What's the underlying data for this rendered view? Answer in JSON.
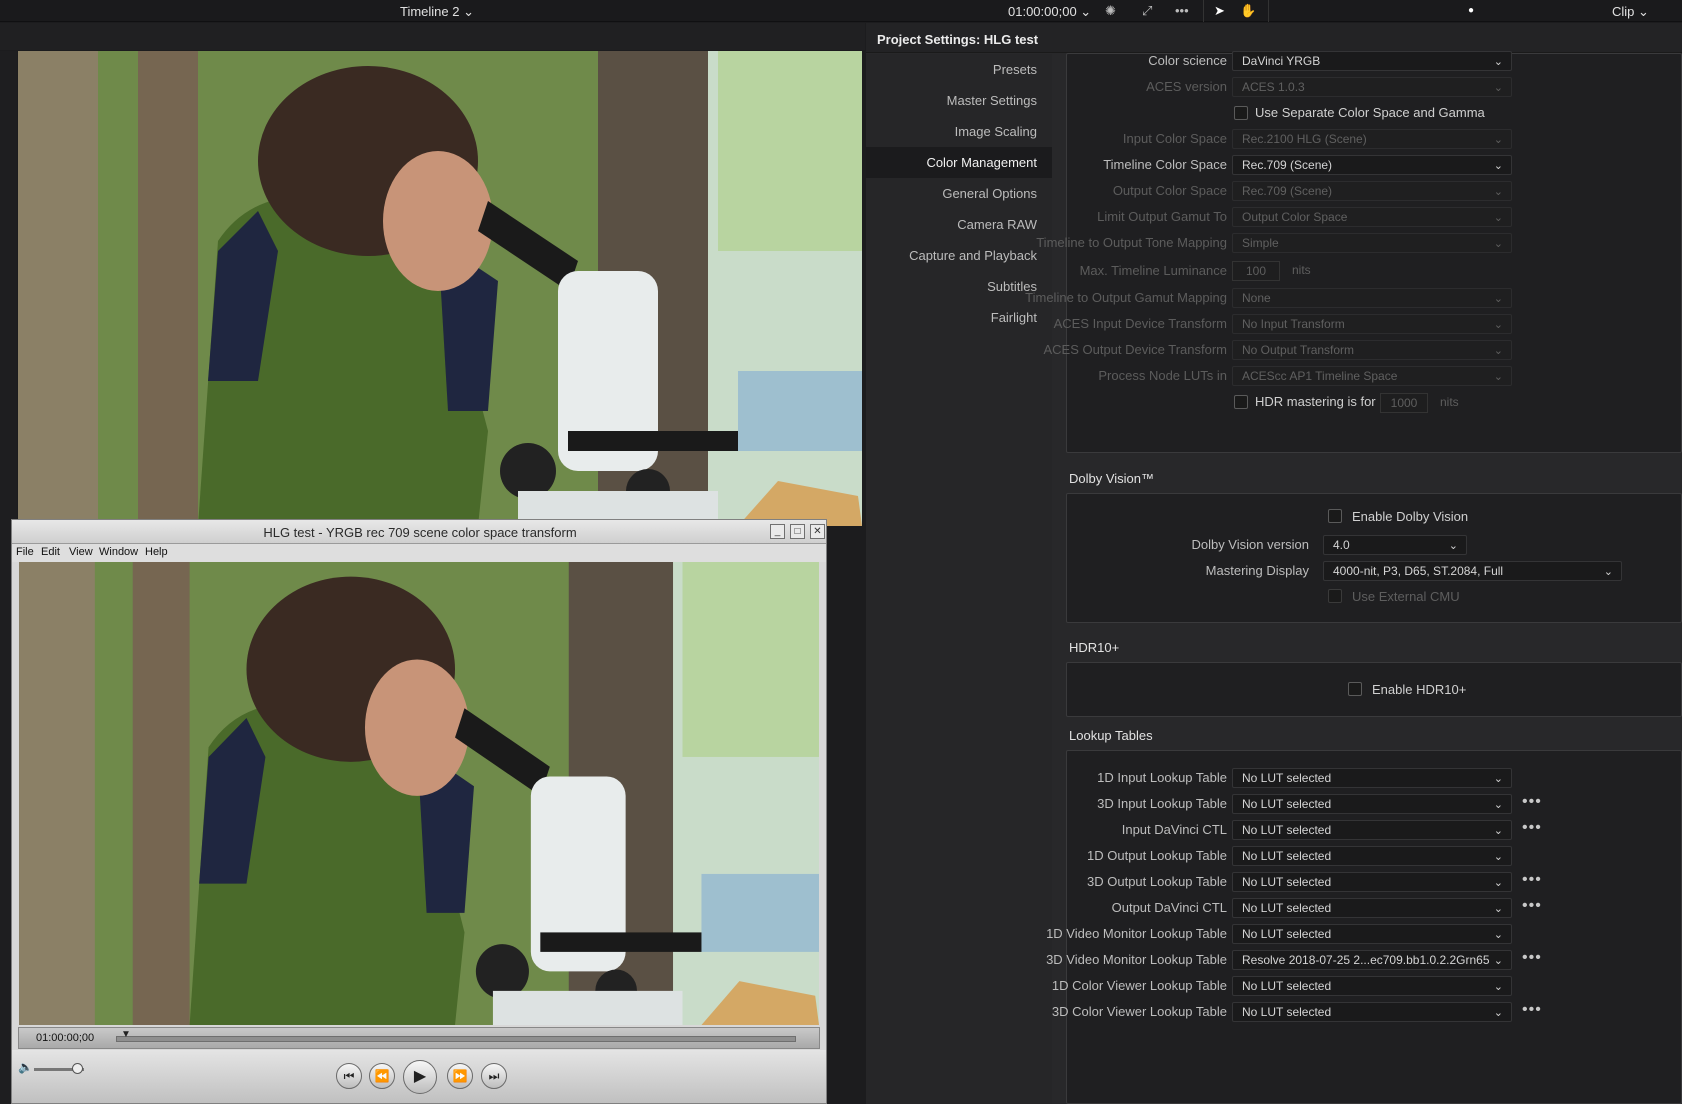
{
  "topbar": {
    "timeline": "Timeline 2",
    "timecode": "01:00:00;00",
    "clip": "Clip",
    "icons": [
      "color-wheel-icon",
      "fullscreen-icon",
      "more-icon",
      "pointer-icon",
      "hand-icon"
    ]
  },
  "settings": {
    "header": "Project Settings:  HLG test",
    "nav": [
      "Presets",
      "Master Settings",
      "Image Scaling",
      "Color Management",
      "General Options",
      "Camera RAW",
      "Capture and Playback",
      "Subtitles",
      "Fairlight"
    ],
    "active_nav": "Color Management",
    "color": {
      "rows": [
        {
          "label": "Color science",
          "value": "DaVinci YRGB",
          "dim": false
        },
        {
          "label": "ACES version",
          "value": "ACES 1.0.3",
          "dim": true
        }
      ],
      "separate_checkbox": "Use Separate Color Space and Gamma",
      "rows2": [
        {
          "label": "Input Color Space",
          "value": "Rec.2100 HLG (Scene)",
          "dim": true
        },
        {
          "label": "Timeline Color Space",
          "value": "Rec.709 (Scene)",
          "dim": false
        },
        {
          "label": "Output Color Space",
          "value": "Rec.709 (Scene)",
          "dim": true
        },
        {
          "label": "Limit Output Gamut To",
          "value": "Output Color Space",
          "dim": true
        },
        {
          "label": "Timeline to Output Tone Mapping",
          "value": "Simple",
          "dim": true
        }
      ],
      "max_lum_label": "Max. Timeline Luminance",
      "max_lum_value": "100",
      "max_lum_unit": "nits",
      "rows3": [
        {
          "label": "Timeline to Output Gamut Mapping",
          "value": "None",
          "dim": true
        },
        {
          "label": "ACES Input Device Transform",
          "value": "No Input Transform",
          "dim": true
        },
        {
          "label": "ACES Output Device Transform",
          "value": "No Output Transform",
          "dim": true
        },
        {
          "label": "Process Node LUTs in",
          "value": "ACEScc AP1 Timeline Space",
          "dim": true
        }
      ],
      "hdr_mastering_label": "HDR mastering is for",
      "hdr_mastering_value": "1000",
      "hdr_mastering_unit": "nits"
    },
    "dolby": {
      "title": "Dolby Vision™",
      "enable": "Enable Dolby Vision",
      "version_label": "Dolby Vision version",
      "version_value": "4.0",
      "mastering_label": "Mastering Display",
      "mastering_value": "4000-nit, P3, D65, ST.2084, Full",
      "external_cmu": "Use External CMU"
    },
    "hdr10": {
      "title": "HDR10+",
      "enable": "Enable HDR10+"
    },
    "luts": {
      "title": "Lookup Tables",
      "rows": [
        {
          "label": "1D Input Lookup Table",
          "value": "No LUT selected",
          "dots": false
        },
        {
          "label": "3D Input Lookup Table",
          "value": "No LUT selected",
          "dots": true
        },
        {
          "label": "Input DaVinci CTL",
          "value": "No LUT selected",
          "dots": true
        },
        {
          "label": "1D Output Lookup Table",
          "value": "No LUT selected",
          "dots": false
        },
        {
          "label": "3D Output Lookup Table",
          "value": "No LUT selected",
          "dots": true
        },
        {
          "label": "Output DaVinci CTL",
          "value": "No LUT selected",
          "dots": true
        },
        {
          "label": "1D Video Monitor Lookup Table",
          "value": "No LUT selected",
          "dots": false
        },
        {
          "label": "3D Video Monitor Lookup Table",
          "value": "Resolve 2018-07-25 2...ec709.bb1.0.2.2Grn65",
          "dots": true
        },
        {
          "label": "1D Color Viewer Lookup Table",
          "value": "No LUT selected",
          "dots": false
        },
        {
          "label": "3D Color Viewer Lookup Table",
          "value": "No LUT selected",
          "dots": true
        }
      ]
    }
  },
  "player": {
    "title": "HLG test - YRGB rec 709 scene color space transform",
    "menu": [
      "File",
      "Edit",
      "View",
      "Window",
      "Help"
    ],
    "timecode": "01:00:00;00"
  }
}
